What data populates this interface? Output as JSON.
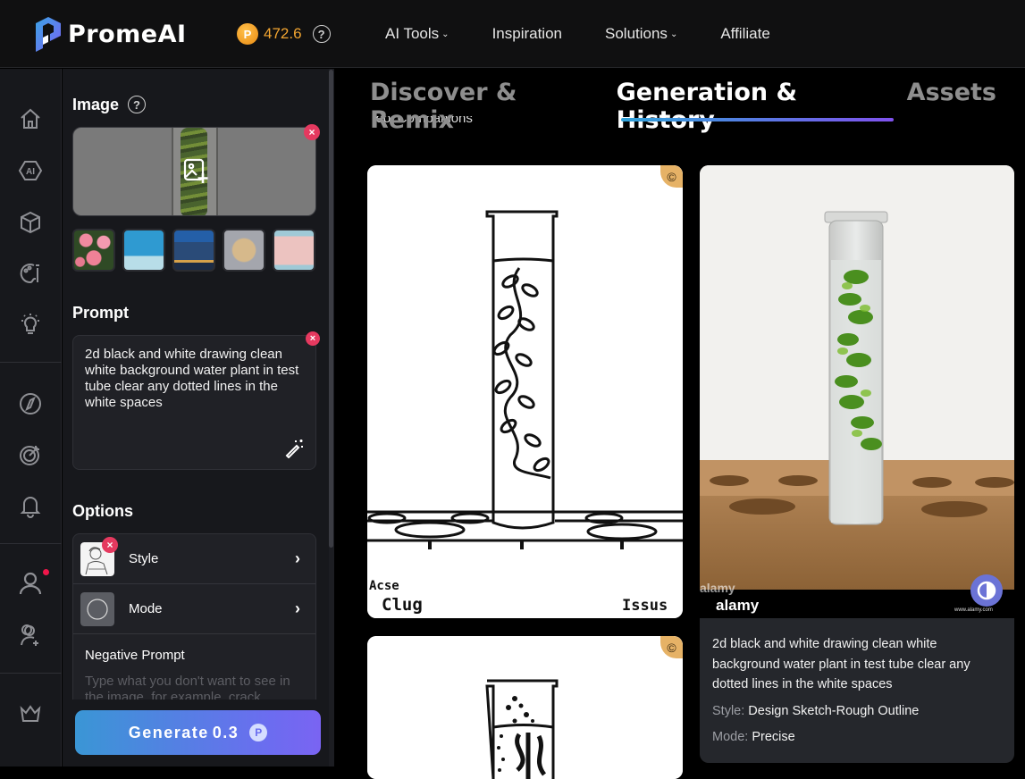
{
  "header": {
    "brand": "PromeAI",
    "credits": "472.6",
    "nav": [
      {
        "label": "AI Tools",
        "has_dropdown": true
      },
      {
        "label": "Inspiration",
        "has_dropdown": false
      },
      {
        "label": "Solutions",
        "has_dropdown": true
      },
      {
        "label": "Affiliate",
        "has_dropdown": false
      }
    ]
  },
  "rail": {
    "icons": [
      "home-icon",
      "ai-icon",
      "cube-icon",
      "palette-icon",
      "lightbulb-icon",
      "compass-icon",
      "target-icon",
      "bell-icon",
      "user-icon",
      "user-add-icon",
      "crown-icon"
    ],
    "notification_dot_color": "#f0164a"
  },
  "panel": {
    "image_section": {
      "title": "Image",
      "help": "?",
      "remove": "×",
      "samples": [
        "roses",
        "people-on-chairs",
        "glass-building",
        "jacket",
        "pink-skirt"
      ]
    },
    "prompt_section": {
      "title": "Prompt",
      "value": "2d black and white drawing clean white background water plant in test tube clear any dotted lines in the white spaces",
      "remove": "×"
    },
    "options_section": {
      "title": "Options",
      "style_label": "Style",
      "mode_label": "Mode",
      "negative_title": "Negative Prompt",
      "negative_placeholder": "Type what you don't want to see in the image, for example, crack"
    },
    "generate": {
      "label": "Generate",
      "cost": "0.3"
    }
  },
  "main": {
    "tabs": [
      {
        "label": "Discover & Remix",
        "active": false
      },
      {
        "label": "Generation & History",
        "active": true
      },
      {
        "label": "Assets",
        "active": false
      }
    ],
    "companion_hint": "Tool Companions",
    "results": [
      {
        "type": "sketch",
        "badge": "©",
        "caption_text": [
          "Acse",
          "Clug",
          "Issus"
        ]
      },
      {
        "type": "photo",
        "watermark": "alamy",
        "watermark_url": "www.alamy.com",
        "prompt": "2d black and white drawing clean white background water plant in test tube clear any dotted lines in the white spaces",
        "style_key": "Style:",
        "style_value": "Design Sketch-Rough Outline",
        "mode_key": "Mode:",
        "mode_value": "Precise"
      },
      {
        "type": "sketch",
        "badge": "©"
      }
    ]
  },
  "colors": {
    "accent_gradient_start": "#3a96d5",
    "accent_gradient_end": "#7a64f2",
    "credit": "#f2a531",
    "remove_badge": "#e5395f"
  }
}
